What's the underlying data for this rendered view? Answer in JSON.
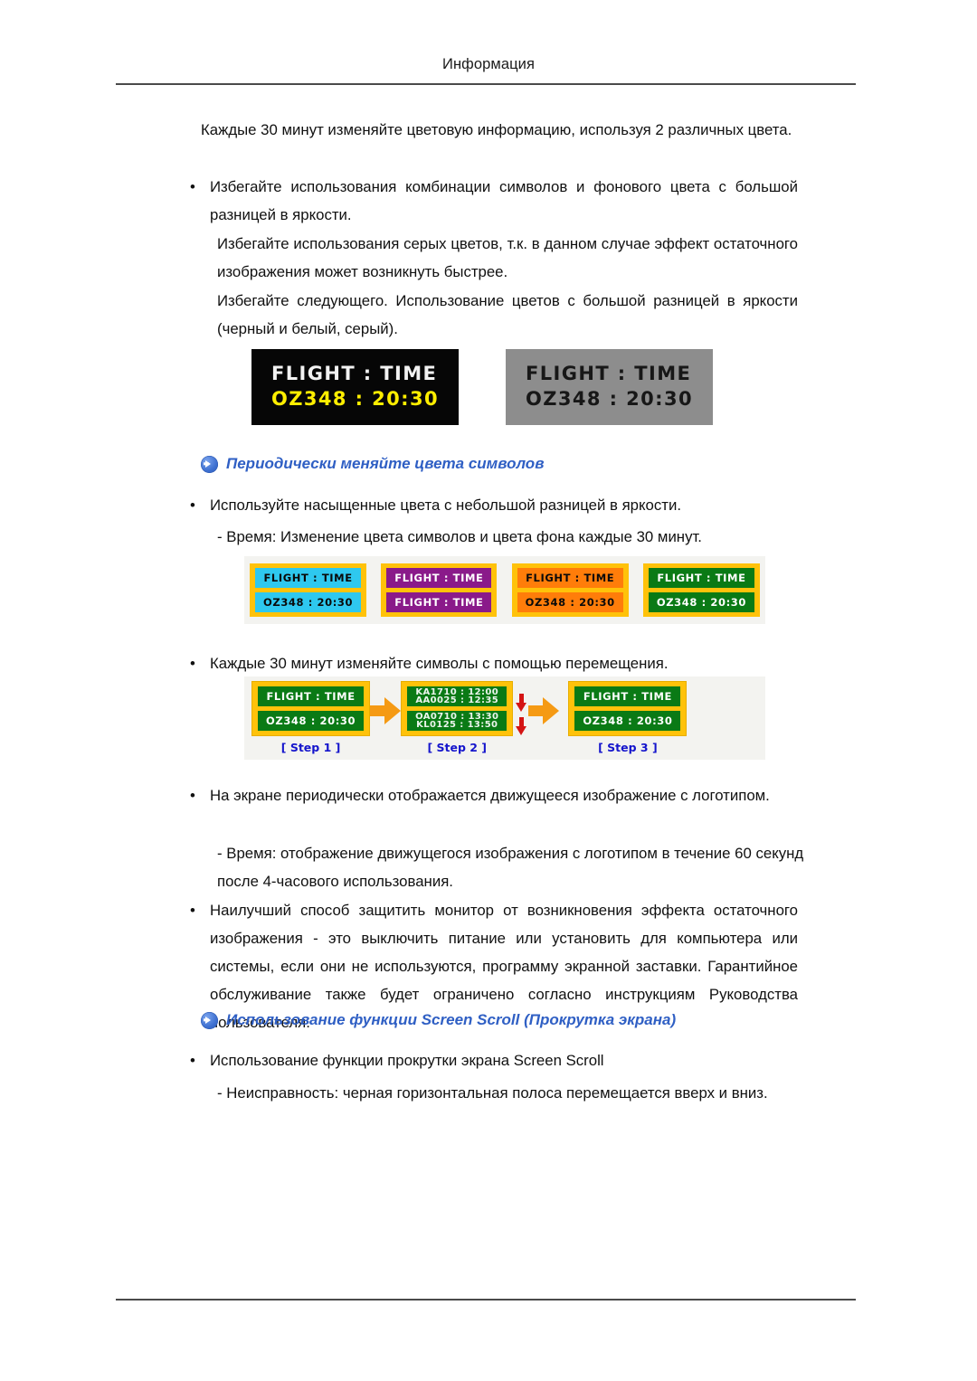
{
  "page": {
    "header_title": "Информация",
    "bullet_glyph": "•"
  },
  "body": {
    "intro_paragraph": "Каждые 30 минут изменяйте цветовую информацию, используя 2 различных цвета.",
    "bullet_contrast": "Избегайте использования комбинации символов и фонового цвета с большой разницей в яркости.",
    "para_gray": "Избегайте использования серых цветов, т.к. в данном случае эффект остаточного изображения может возникнуть быстрее.",
    "para_avoid": "Избегайте следующего. Использование цветов с большой разницей в яркости (черный и белый, серый).",
    "section_colors_heading": "Периодически меняйте цвета символов",
    "bullet_saturated": "Используйте насыщенные цвета с небольшой разницей в яркости.",
    "note_time_colors": "- Время: Изменение цвета символов и цвета фона каждые 30 минут.",
    "bullet_move": "Каждые 30 минут изменяйте символы с помощью перемещения.",
    "bullet_logo": "На экране периодически отображается движущееся изображение с логотипом.",
    "note_time_logo": "- Время: отображение движущегося изображения с логотипом в течение 60 секунд после 4-часового использования.",
    "bullet_best": "Наилучший способ защитить монитор от возникновения эффекта остаточного изображения - это выключить питание или установить для компьютера или системы, если они не используются, программу экранной заставки. Гарантийное обслуживание также будет ограничено согласно инструкциям Руководства пользователя.",
    "section_scroll_heading": "Использование функции Screen Scroll (Прокрутка экрана)",
    "bullet_scroll": "Использование функции прокрутки экрана Screen Scroll",
    "note_scroll": "- Неисправность: черная горизонтальная полоса перемещается вверх и вниз."
  },
  "figure_lcd_pair": {
    "dark_panel": {
      "line1": "FLIGHT : TIME",
      "line2": "OZ348  :  20:30",
      "bg_color": "#060606",
      "line1_color": "#f2f2f2",
      "line2_color": "#ffee00"
    },
    "gray_panel": {
      "line1": "FLIGHT : TIME",
      "line2": "OZ348  :  20:30",
      "bg_color": "#8d8d8d",
      "text_color": "#171717"
    }
  },
  "figure_color_panels": {
    "border_color": "#ffc20a",
    "panels": [
      {
        "name": "cyan",
        "bg_color": "#2ec8ef",
        "text_color": "#0a0a0a",
        "line1": "FLIGHT : TIME",
        "line2": "OZ348  :  20:30"
      },
      {
        "name": "purple",
        "bg_color": "#8a1a8a",
        "text_color": "#ffffff",
        "line1": "FLIGHT : TIME",
        "line2": "FLIGHT : TIME"
      },
      {
        "name": "orange",
        "bg_color": "#ff7d0a",
        "text_color": "#0a0a0a",
        "line1": "FLIGHT : TIME",
        "line2": "OZ348  :  20:30"
      },
      {
        "name": "green",
        "bg_color": "#0a7a15",
        "text_color": "#ffffff",
        "line1": "FLIGHT : TIME",
        "line2": "OZ348  :  20:30"
      }
    ]
  },
  "figure_steps": {
    "arrow_color": "#f59a14",
    "red_arrow_color": "#d41414",
    "label_color": "#1414cc",
    "steps": [
      {
        "label": "[ Step 1 ]",
        "line1": "FLIGHT : TIME",
        "line2": "OZ348  :  20:30"
      },
      {
        "label": "[ Step 2 ]",
        "line1_top": "KA1710  :  12:00",
        "line1_bottom": "AA0025  :  12:35",
        "line2_top": "OA0710  :  13:30",
        "line2_bottom": "KL0125  :  13:50"
      },
      {
        "label": "[ Step 3 ]",
        "line1": "FLIGHT : TIME",
        "line2": "OZ348  :  20:30"
      }
    ]
  }
}
